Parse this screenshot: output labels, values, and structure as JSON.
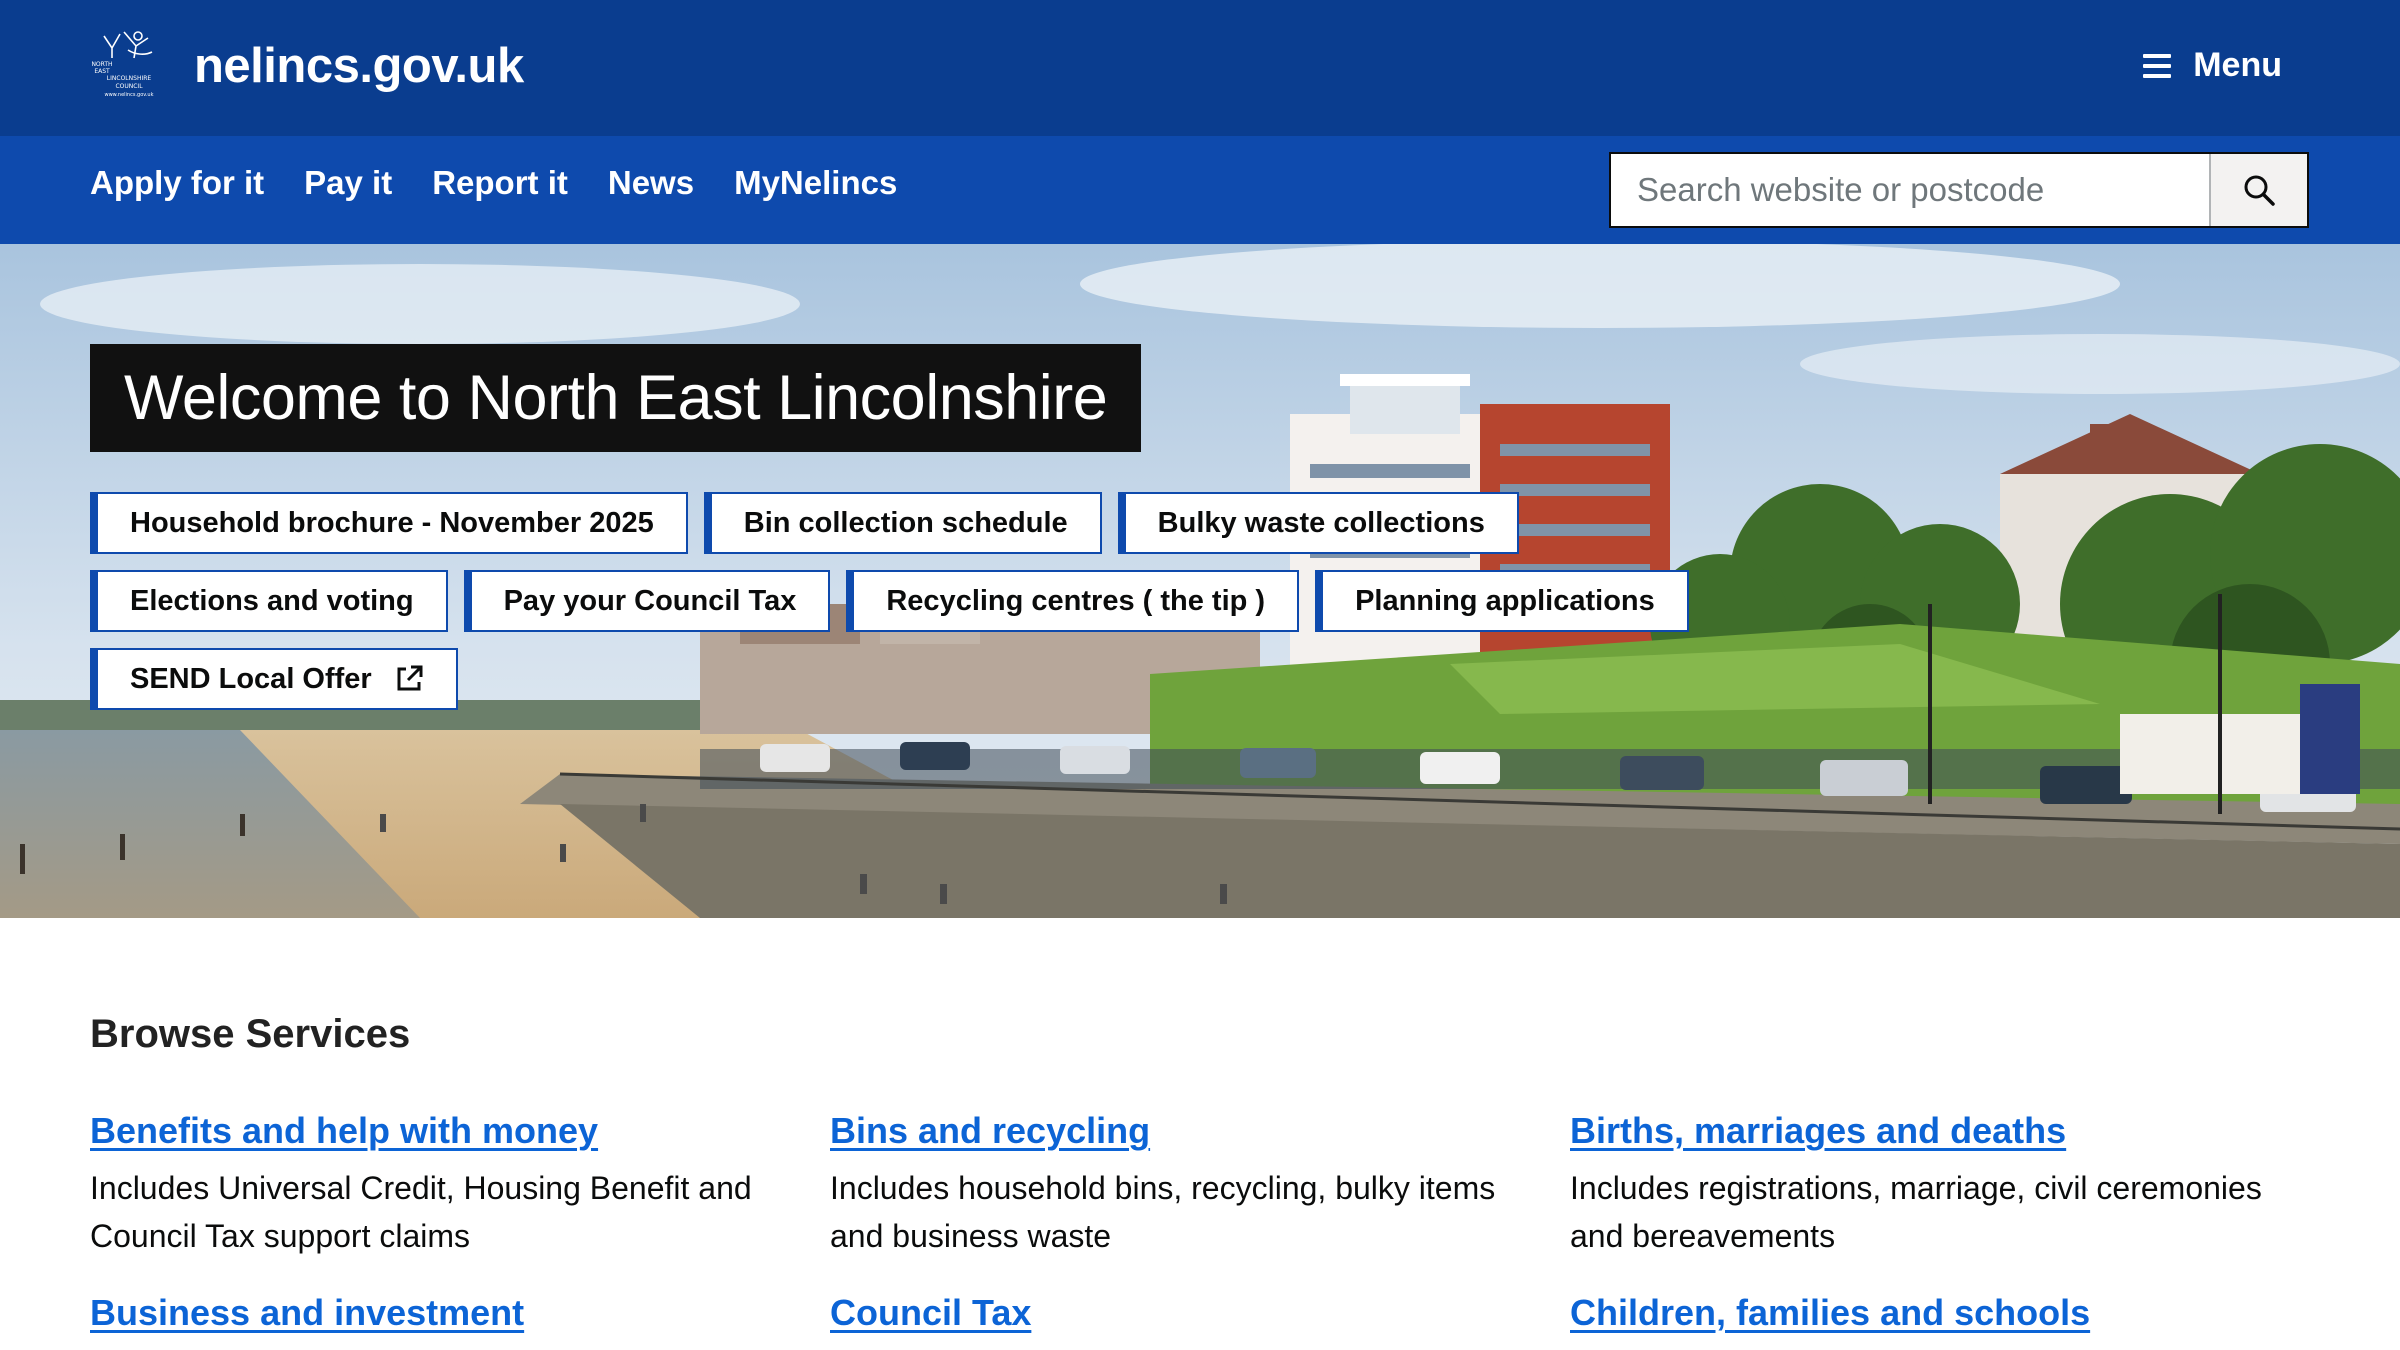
{
  "header": {
    "site_name": "nelincs.gov.uk",
    "logo_lines": [
      "NORTH",
      "EAST",
      "LINCOLNSHIRE",
      "COUNCIL",
      "www.nelincs.gov.uk"
    ],
    "menu_label": "Menu"
  },
  "nav": {
    "links": [
      "Apply for it",
      "Pay it",
      "Report it",
      "News",
      "MyNelincs"
    ],
    "search_placeholder": "Search website or postcode"
  },
  "hero": {
    "title": "Welcome to North East Lincolnshire",
    "quick_links": [
      "Household brochure - November 2025",
      "Bin collection schedule",
      "Bulky waste collections",
      "Elections and voting",
      "Pay your Council Tax",
      "Recycling centres ( the tip )",
      "Planning applications",
      "SEND Local Offer"
    ]
  },
  "browse": {
    "title": "Browse Services",
    "services": [
      {
        "title": "Benefits and help with money",
        "description": "Includes Universal Credit, Housing Benefit and Council Tax support claims"
      },
      {
        "title": "Bins and recycling",
        "description": "Includes household bins, recycling, bulky items and business waste"
      },
      {
        "title": "Births, marriages and deaths",
        "description": "Includes registrations, marriage, civil ceremonies and bereavements"
      },
      {
        "title": "Business and investment",
        "description": ""
      },
      {
        "title": "Council Tax",
        "description": ""
      },
      {
        "title": "Children, families and schools",
        "description": ""
      }
    ]
  },
  "colors": {
    "header_bg": "#0a3d8f",
    "nav_bg": "#0e4aad",
    "link": "#0c64d6",
    "hero_title_bg": "#111111"
  }
}
